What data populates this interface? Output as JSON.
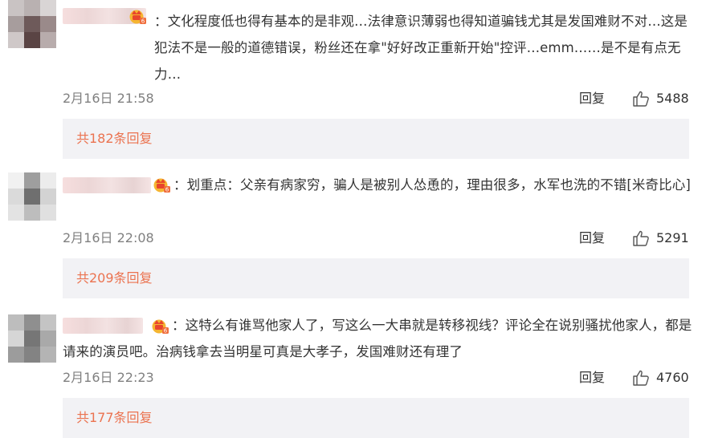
{
  "colors": {
    "link_orange": "#eb7350",
    "meta_gray": "#808080",
    "box_bg": "#f2f2f5",
    "badge_gold": "#f0a22e",
    "badge_red": "#e8452c"
  },
  "icons": {
    "badge": "crown-badge-icon",
    "like": "thumbs-up-icon"
  },
  "comments": [
    {
      "text": "：文化程度低也得有基本的是非观…法律意识薄弱也得知道骗钱尤其是发国难财不对…这是犯法不是一般的道德错误，粉丝还在拿\"好好改正重新开始\"控评…emm……是不是有点无力…",
      "date": "2月16日 21:58",
      "reply_label": "回复",
      "likes": "5488",
      "more_replies": "共182条回复"
    },
    {
      "text": "：划重点：父亲有病家穷，骗人是被别人怂恿的，理由很多，水军也洗的不错[米奇比心]",
      "date": "2月16日 22:08",
      "reply_label": "回复",
      "likes": "5291",
      "more_replies": "共209条回复"
    },
    {
      "text": "：这特么有谁骂他家人了，写这么一大串就是转移视线？评论全在说别骚扰他家人，都是请来的演员吧。治病钱拿去当明星可真是大孝子，发国难财还有理了",
      "date": "2月16日 22:23",
      "reply_label": "回复",
      "likes": "4760",
      "more_replies": "共177条回复"
    }
  ]
}
